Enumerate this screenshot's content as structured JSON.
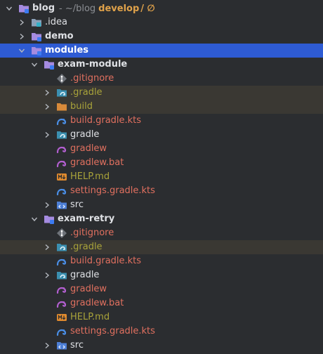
{
  "project": {
    "name": "blog",
    "path": "- ~/blog",
    "branch": "develop",
    "branch_suffix": "/ ∅"
  },
  "items": [
    {
      "label": "blog",
      "depth": 0,
      "arrow": "down",
      "icon": "module-folder-icon",
      "style": "bold"
    },
    {
      "label": ".idea",
      "depth": 1,
      "arrow": "right",
      "icon": "folder-icon",
      "style": "default"
    },
    {
      "label": "demo",
      "depth": 1,
      "arrow": "right",
      "icon": "module-folder-icon",
      "style": "bold"
    },
    {
      "label": "modules",
      "depth": 1,
      "arrow": "down",
      "icon": "module-folder-icon",
      "style": "bold",
      "selected": true
    },
    {
      "label": "exam-module",
      "depth": 2,
      "arrow": "down",
      "icon": "module-folder-icon",
      "style": "bold"
    },
    {
      "label": ".gitignore",
      "depth": 3,
      "arrow": "none",
      "icon": "git-icon",
      "style": "new"
    },
    {
      "label": ".gradle",
      "depth": 3,
      "arrow": "right",
      "icon": "gradle-folder-icon",
      "style": "ignored",
      "ignored": true
    },
    {
      "label": "build",
      "depth": 3,
      "arrow": "right",
      "icon": "orange-folder-icon",
      "style": "ignored",
      "ignored": true
    },
    {
      "label": "build.gradle.kts",
      "depth": 3,
      "arrow": "none",
      "icon": "gradle-icon",
      "style": "new"
    },
    {
      "label": "gradle",
      "depth": 3,
      "arrow": "right",
      "icon": "gradle-folder-icon",
      "style": "default"
    },
    {
      "label": "gradlew",
      "depth": 3,
      "arrow": "none",
      "icon": "gradlew-icon",
      "style": "new"
    },
    {
      "label": "gradlew.bat",
      "depth": 3,
      "arrow": "none",
      "icon": "gradlew-icon",
      "style": "new"
    },
    {
      "label": "HELP.md",
      "depth": 3,
      "arrow": "none",
      "icon": "markdown-icon",
      "style": "ignored"
    },
    {
      "label": "settings.gradle.kts",
      "depth": 3,
      "arrow": "none",
      "icon": "gradle-icon",
      "style": "new"
    },
    {
      "label": "src",
      "depth": 3,
      "arrow": "right",
      "icon": "source-folder-icon",
      "style": "default"
    },
    {
      "label": "exam-retry",
      "depth": 2,
      "arrow": "down",
      "icon": "module-folder-icon",
      "style": "bold"
    },
    {
      "label": ".gitignore",
      "depth": 3,
      "arrow": "none",
      "icon": "git-icon",
      "style": "new"
    },
    {
      "label": ".gradle",
      "depth": 3,
      "arrow": "right",
      "icon": "gradle-folder-icon",
      "style": "ignored",
      "ignored": true
    },
    {
      "label": "build.gradle.kts",
      "depth": 3,
      "arrow": "none",
      "icon": "gradle-icon",
      "style": "new"
    },
    {
      "label": "gradle",
      "depth": 3,
      "arrow": "right",
      "icon": "gradle-folder-icon",
      "style": "default"
    },
    {
      "label": "gradlew",
      "depth": 3,
      "arrow": "none",
      "icon": "gradlew-icon",
      "style": "new"
    },
    {
      "label": "gradlew.bat",
      "depth": 3,
      "arrow": "none",
      "icon": "gradlew-icon",
      "style": "new"
    },
    {
      "label": "HELP.md",
      "depth": 3,
      "arrow": "none",
      "icon": "markdown-icon",
      "style": "ignored"
    },
    {
      "label": "settings.gradle.kts",
      "depth": 3,
      "arrow": "none",
      "icon": "gradle-icon",
      "style": "new"
    },
    {
      "label": "src",
      "depth": 3,
      "arrow": "right",
      "icon": "source-folder-icon",
      "style": "default"
    }
  ],
  "colors": {
    "background": "#2b2d30",
    "selection": "#2e5bd3",
    "ignored_row": "#3a3833",
    "text_default": "#dfe1e5",
    "text_ignored": "#a9a33a",
    "text_new": "#e1705f",
    "branch": "#e0a24a"
  }
}
